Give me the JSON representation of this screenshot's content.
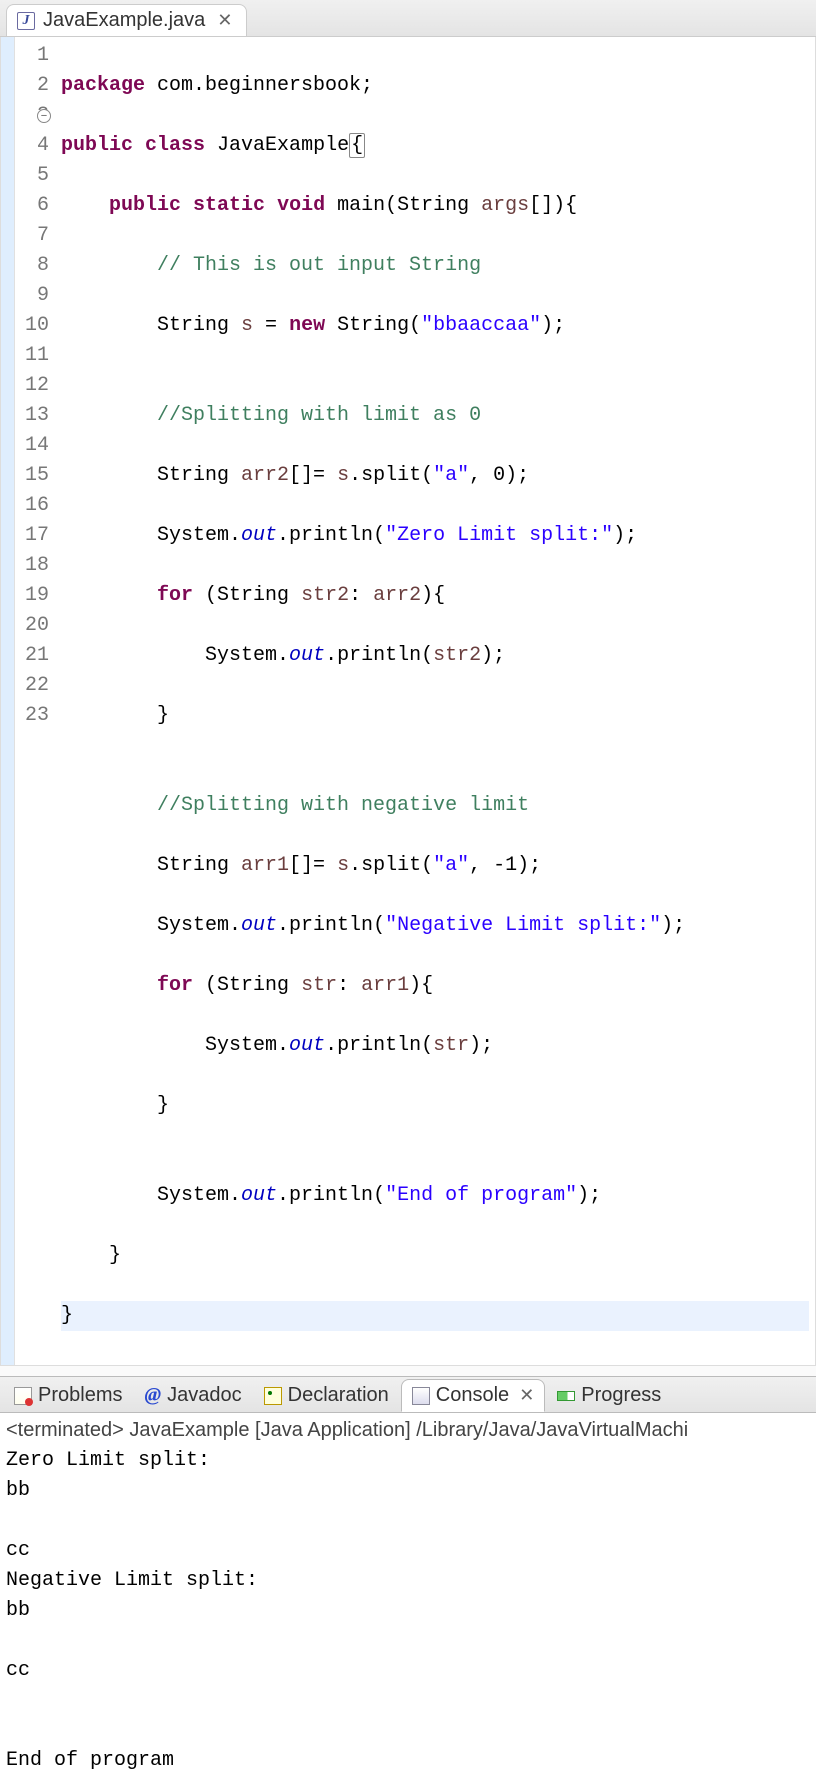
{
  "editor": {
    "tab": {
      "filename": "JavaExample.java",
      "icon": "java-file"
    },
    "lines": {
      "l1": {
        "n": "1",
        "t_kw1": "package",
        "t_nm": " com.beginnersbook;"
      },
      "l2": {
        "n": "2",
        "t_kw1": "public",
        "t_kw2": "class",
        "t_nm": " JavaExample",
        "t_brace": "{"
      },
      "l3": {
        "n": "3",
        "t_kw1": "public",
        "t_kw2": "static",
        "t_kw3": "void",
        "t_nm": " main(String ",
        "t_var": "args",
        "t_tail": "[]){"
      },
      "l4": {
        "n": "4",
        "t_cm": "// This is out input String"
      },
      "l5": {
        "n": "5",
        "t_pre": "String ",
        "t_var": "s",
        "t_mid": " = ",
        "t_kw": "new",
        "t_call": " String(",
        "t_str": "\"bbaaccaa\"",
        "t_tail": ");"
      },
      "l6": {
        "n": "6",
        "t": ""
      },
      "l7": {
        "n": "7",
        "t_cm": "//Splitting with limit as 0"
      },
      "l8": {
        "n": "8",
        "t_pre": "String ",
        "t_var": "arr2",
        "t_mid": "[]= ",
        "t_v2": "s",
        "t_call": ".split(",
        "t_str": "\"a\"",
        "t_tail": ", 0);"
      },
      "l9": {
        "n": "9",
        "t_pre": "System.",
        "t_fld": "out",
        "t_mid": ".println(",
        "t_str": "\"Zero Limit split:\"",
        "t_tail": ");"
      },
      "l10": {
        "n": "10",
        "t_kw": "for",
        "t_mid": " (String ",
        "t_var": "str2",
        "t_mid2": ": ",
        "t_v2": "arr2",
        "t_tail": "){"
      },
      "l11": {
        "n": "11",
        "t_pre": "System.",
        "t_fld": "out",
        "t_mid": ".println(",
        "t_var": "str2",
        "t_tail": ");"
      },
      "l12": {
        "n": "12",
        "t": "}"
      },
      "l13": {
        "n": "13",
        "t": ""
      },
      "l14": {
        "n": "14",
        "t_cm": "//Splitting with negative limit"
      },
      "l15": {
        "n": "15",
        "t_pre": "String ",
        "t_var": "arr1",
        "t_mid": "[]= ",
        "t_v2": "s",
        "t_call": ".split(",
        "t_str": "\"a\"",
        "t_tail": ", -1);"
      },
      "l16": {
        "n": "16",
        "t_pre": "System.",
        "t_fld": "out",
        "t_mid": ".println(",
        "t_str": "\"Negative Limit split:\"",
        "t_tail": ");"
      },
      "l17": {
        "n": "17",
        "t_kw": "for",
        "t_mid": " (String ",
        "t_var": "str",
        "t_mid2": ": ",
        "t_v2": "arr1",
        "t_tail": "){"
      },
      "l18": {
        "n": "18",
        "t_pre": "System.",
        "t_fld": "out",
        "t_mid": ".println(",
        "t_var": "str",
        "t_tail": ");"
      },
      "l19": {
        "n": "19",
        "t": "}"
      },
      "l20": {
        "n": "20",
        "t": ""
      },
      "l21": {
        "n": "21",
        "t_pre": "System.",
        "t_fld": "out",
        "t_mid": ".println(",
        "t_str": "\"End of program\"",
        "t_tail": ");"
      },
      "l22": {
        "n": "22",
        "t": "}"
      },
      "l23": {
        "n": "23",
        "t": "}"
      }
    }
  },
  "panel": {
    "tabs": {
      "problems": "Problems",
      "javadoc": "Javadoc",
      "declaration": "Declaration",
      "console": "Console",
      "progress": "Progress"
    }
  },
  "console": {
    "status": "<terminated> JavaExample [Java Application] /Library/Java/JavaVirtualMachi",
    "output": "Zero Limit split:\nbb\n\ncc\nNegative Limit split:\nbb\n\ncc\n\n\nEnd of program"
  }
}
